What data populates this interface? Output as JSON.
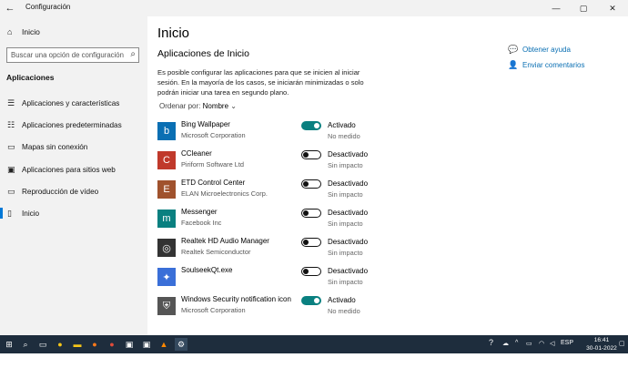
{
  "window": {
    "title": "Configuración",
    "back_icon": "←",
    "minimize_icon": "—",
    "maximize_icon": "▢",
    "close_icon": "✕"
  },
  "sidebar": {
    "home_label": "Inicio",
    "search_placeholder": "Buscar una opción de configuración",
    "section": "Aplicaciones",
    "items": [
      {
        "label": "Aplicaciones y características",
        "icon": "list-icon"
      },
      {
        "label": "Aplicaciones predeterminadas",
        "icon": "default-apps-icon"
      },
      {
        "label": "Mapas sin conexión",
        "icon": "map-icon"
      },
      {
        "label": "Aplicaciones para sitios web",
        "icon": "website-apps-icon"
      },
      {
        "label": "Reproducción de vídeo",
        "icon": "video-icon"
      },
      {
        "label": "Inicio",
        "icon": "startup-icon"
      }
    ]
  },
  "main": {
    "title": "Inicio",
    "section_title": "Aplicaciones de Inicio",
    "description": "Es posible configurar las aplicaciones para que se inicien al iniciar sesión. En la mayoría de los casos, se iniciarán minimizadas o solo podrán iniciar una tarea en segundo plano.",
    "sort_label": "Ordenar por:",
    "sort_value": "Nombre",
    "apps": [
      {
        "name": "Bing Wallpaper",
        "publisher": "Microsoft Corporation",
        "state": "Activado",
        "impact": "No medido",
        "on": true,
        "color": "#0a6fb3"
      },
      {
        "name": "CCleaner",
        "publisher": "Piriform Software Ltd",
        "state": "Desactivado",
        "impact": "Sin impacto",
        "on": false,
        "color": "#c0392b"
      },
      {
        "name": "ETD Control Center",
        "publisher": "ELAN Microelectronics Corp.",
        "state": "Desactivado",
        "impact": "Sin impacto",
        "on": false,
        "color": "#a0522d"
      },
      {
        "name": "Messenger",
        "publisher": "Facebook Inc",
        "state": "Desactivado",
        "impact": "Sin impacto",
        "on": false,
        "color": "#0a8080"
      },
      {
        "name": "Realtek HD Audio Manager",
        "publisher": "Realtek Semiconductor",
        "state": "Desactivado",
        "impact": "Sin impacto",
        "on": false,
        "color": "#333333"
      },
      {
        "name": "SoulseekQt.exe",
        "publisher": "",
        "state": "Desactivado",
        "impact": "Sin impacto",
        "on": false,
        "color": "#3a6fd8"
      },
      {
        "name": "Windows Security notification icon",
        "publisher": "Microsoft Corporation",
        "state": "Activado",
        "impact": "No medido",
        "on": true,
        "color": "#555555"
      }
    ],
    "help_label": "Obtener ayuda",
    "feedback_label": "Enviar comentarios"
  },
  "taskbar": {
    "language": "ESP",
    "time": "16:41",
    "date": "30-01-2022"
  }
}
